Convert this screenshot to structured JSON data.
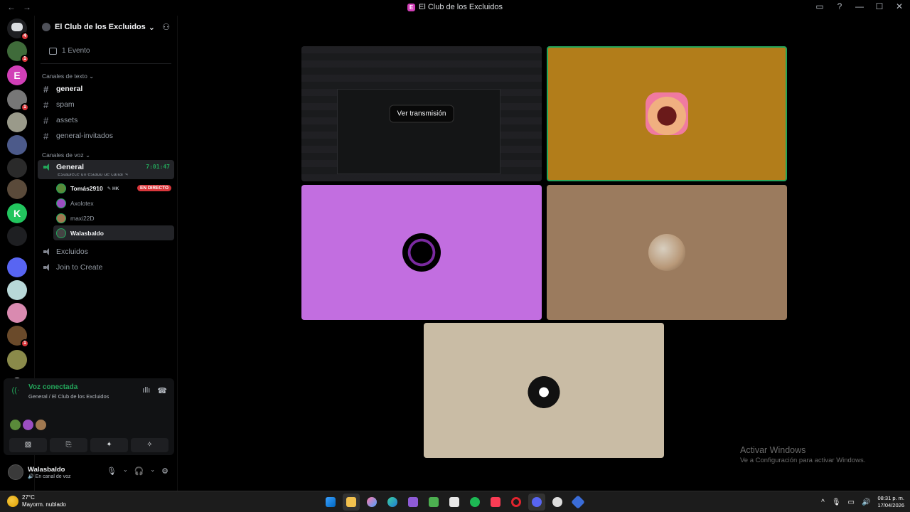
{
  "window": {
    "title": "El Club de los Excluidos",
    "back_glyph": "←",
    "forward_glyph": "→",
    "controls": {
      "inbox": "▭",
      "help": "?",
      "minimize": "—",
      "maximize": "☐",
      "close": "✕"
    }
  },
  "server_rail": {
    "home_badge": "4",
    "servers": [
      {
        "name": "server-1",
        "badge": "1",
        "color": "#3f6b3a"
      },
      {
        "name": "server-2",
        "badge": "",
        "color": "#d13fb7",
        "label": "E"
      },
      {
        "name": "server-3",
        "badge": "1",
        "color": "#777"
      },
      {
        "name": "server-4",
        "badge": "",
        "color": "#9a9a8a"
      },
      {
        "name": "server-5",
        "badge": "",
        "color": "#4c5a8a"
      },
      {
        "name": "server-6",
        "badge": "",
        "color": "#2a2a2a"
      },
      {
        "name": "server-7",
        "badge": "",
        "color": "#5a4a3a"
      },
      {
        "name": "server-8",
        "badge": "",
        "color": "#22c55e",
        "label": "K"
      },
      {
        "name": "server-9",
        "badge": "",
        "color": "#1e1f22"
      },
      {
        "name": "server-10",
        "badge": "",
        "color": "#5865f2"
      },
      {
        "name": "server-11",
        "badge": "",
        "color": "#b8d8d8"
      },
      {
        "name": "server-12",
        "badge": "",
        "color": "#d98ab0"
      },
      {
        "name": "server-13",
        "badge": "1",
        "color": "#6a4a2a"
      },
      {
        "name": "server-14",
        "badge": "",
        "color": "#8a8a4a"
      }
    ],
    "add_glyph": "+"
  },
  "guild": {
    "name": "El Club de los Excluidos",
    "chevron": "⌄",
    "events_label": "1 Evento",
    "text_category": "Canales de texto",
    "text_channels": [
      "general",
      "spam",
      "assets",
      "general-invitados"
    ],
    "voice_category": "Canales de voz",
    "active_voice": {
      "name": "General",
      "timer": "7:01:47",
      "status": "Establece un estado de canal ✎"
    },
    "voice_users": [
      {
        "name": "Tomás2910",
        "extra": "✎ HK",
        "live": "EN DIRECTO",
        "color": "#5a8a3a"
      },
      {
        "name": "Axolotex",
        "extra": "",
        "live": "",
        "color": "#9b4ec2"
      },
      {
        "name": "maxi22D",
        "extra": "",
        "live": "",
        "color": "#a07850"
      },
      {
        "name": "Walasbaldo",
        "extra": "",
        "live": "",
        "color": "#444"
      }
    ],
    "other_voice": [
      "Excluidos",
      "Join to Create"
    ]
  },
  "voice_panel": {
    "title": "Voz conectada",
    "subtitle": "General / El Club de los Excluidos",
    "wave_glyph": "ıllı",
    "hangup_glyph": "☎",
    "avatar_colors": [
      "#5a8a3a",
      "#9b4ec2",
      "#a07850"
    ],
    "buttons": [
      "▧",
      "⎘",
      "✦",
      "✧"
    ]
  },
  "user": {
    "name": "Walasbaldo",
    "status": "🔊 En canal de voz",
    "mic_glyph": "🎙",
    "headset_glyph": "🎧",
    "settings_glyph": "⚙"
  },
  "stage": {
    "stream_button": "Ver transmisión",
    "tiles": [
      {
        "name": "stream-tile",
        "bg": "#1b1c1e"
      },
      {
        "name": "tomas-tile",
        "bg": "#b27d1a"
      },
      {
        "name": "axolotex-tile",
        "bg": "#c26ee0"
      },
      {
        "name": "maxi-tile",
        "bg": "#9b7b5e"
      },
      {
        "name": "walasbaldo-tile",
        "bg": "#c9bca5"
      }
    ]
  },
  "watermark": {
    "line1": "Activar Windows",
    "line2": "Ve a Configuración para activar Windows."
  },
  "taskbar": {
    "temp": "27°C",
    "weather": "Mayorm. nublado",
    "time": "08:31 p. m.",
    "date": "17/04/2026",
    "tray": [
      "^",
      "🎙",
      "▭",
      "🔊"
    ]
  }
}
